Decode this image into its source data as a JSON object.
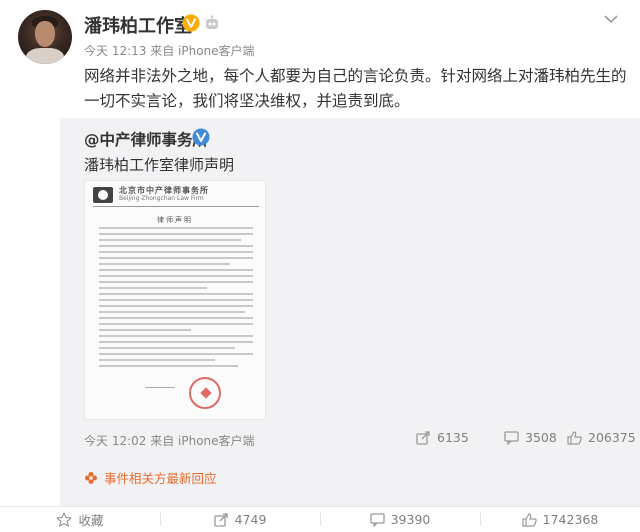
{
  "post": {
    "author": "潘玮柏工作室",
    "meta": "今天 12:13 来自 iPhone客户端",
    "text_line1": "网络并非法外之地，每个人都要为自己的言论负责。针对网络上对潘玮柏先生的",
    "text_line2": "一切不实言论，我们将坚决维权，并追责到底。",
    "icons": {
      "verified": "verified-v-icon",
      "robot": "robot-badge-icon",
      "menu": "chevron-down-icon"
    }
  },
  "repost": {
    "author": "@中产律师事务所",
    "text": "潘玮柏工作室律师声明",
    "doc": {
      "header_cn": "北京市中产律师事务所",
      "header_en": "Beijing Zhongchan Law Firm",
      "title": "律师声明"
    },
    "meta": "今天 12:02 来自 iPhone客户端",
    "shares": "6135",
    "comments": "3508",
    "likes": "206375",
    "related": "事件相关方最新回应"
  },
  "actions": {
    "favorite": "收藏",
    "shares": "4749",
    "comments": "39390",
    "likes": "1742368"
  },
  "colors": {
    "accent": "#e86b2d",
    "verified": "#ffaa00",
    "meta": "#888888"
  }
}
